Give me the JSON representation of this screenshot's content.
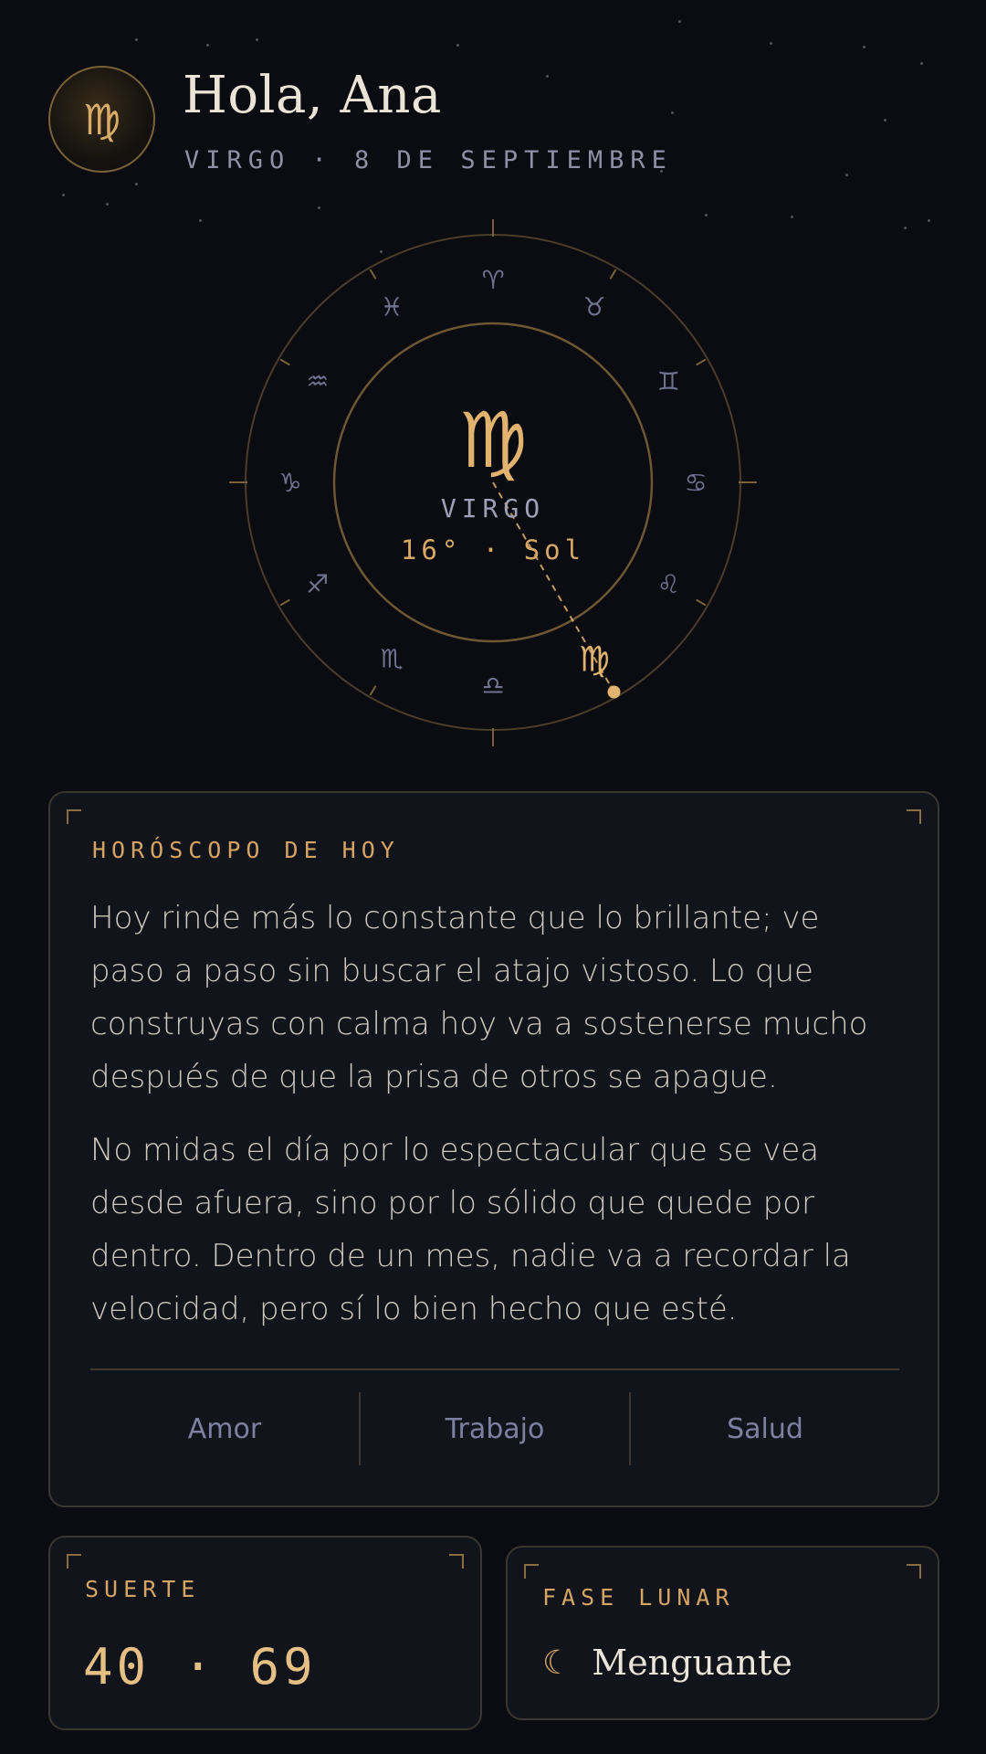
{
  "header": {
    "avatar_glyph": "♍",
    "greeting": "Hola, Ana",
    "subtitle": "VIRGO · 8 DE SEPTIEMBRE"
  },
  "wheel": {
    "signs": [
      {
        "name": "aries",
        "glyph": "♈"
      },
      {
        "name": "taurus",
        "glyph": "♉"
      },
      {
        "name": "gemini",
        "glyph": "♊"
      },
      {
        "name": "cancer",
        "glyph": "♋"
      },
      {
        "name": "leo",
        "glyph": "♌"
      },
      {
        "name": "virgo",
        "glyph": "♍"
      },
      {
        "name": "libra",
        "glyph": "♎"
      },
      {
        "name": "scorpio",
        "glyph": "♏"
      },
      {
        "name": "sagittarius",
        "glyph": "♐"
      },
      {
        "name": "capricorn",
        "glyph": "♑"
      },
      {
        "name": "aquarius",
        "glyph": "♒"
      },
      {
        "name": "pisces",
        "glyph": "♓"
      }
    ],
    "center_glyph": "♍",
    "center_name": "VIRGO",
    "center_detail": "16° · Sol",
    "colors": {
      "accent": "#e2b36e",
      "muted_glyph": "#6f7290",
      "ring": "#6e5733"
    }
  },
  "horoscope": {
    "label": "HORÓSCOPO DE HOY",
    "paragraphs": [
      "Hoy rinde más lo constante que lo brillante; ve paso a paso sin buscar el atajo vistoso. Lo que construyas con calma hoy va a sostenerse mucho después de que la prisa de otros se apague.",
      "No midas el día por lo espectacular que se vea desde afuera, sino por lo sólido que quede por dentro. Dentro de un mes, nadie va a recordar la velocidad, pero sí lo bien hecho que esté."
    ],
    "tabs": [
      "Amor",
      "Trabajo",
      "Salud"
    ]
  },
  "luck": {
    "label": "SUERTE",
    "value": "40 · 69"
  },
  "moon": {
    "label": "FASE LUNAR",
    "icon": "crescent-moon-icon",
    "value": "Menguante"
  }
}
